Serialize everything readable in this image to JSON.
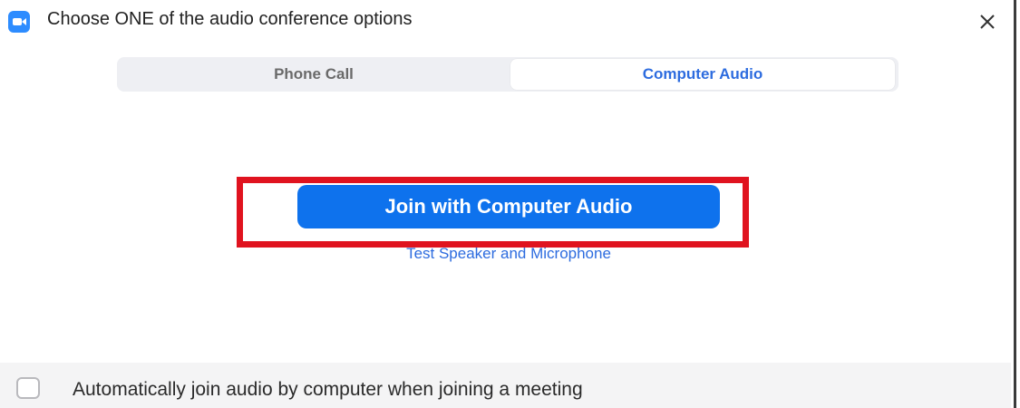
{
  "dialog": {
    "title": "Choose ONE of the audio conference options",
    "icons": {
      "app": "zoom-camera-icon",
      "close": "close-icon"
    }
  },
  "tabs": [
    {
      "label": "Phone Call",
      "selected": false
    },
    {
      "label": "Computer Audio",
      "selected": true
    }
  ],
  "main": {
    "join_button_label": "Join with Computer Audio",
    "test_link_label": "Test Speaker and Microphone"
  },
  "footer": {
    "auto_join_label": "Automatically join audio by computer when joining a meeting",
    "auto_join_checked": false
  },
  "colors": {
    "accent": "#0e72ed",
    "link": "#2d6cdf",
    "highlight": "#e0131f"
  }
}
